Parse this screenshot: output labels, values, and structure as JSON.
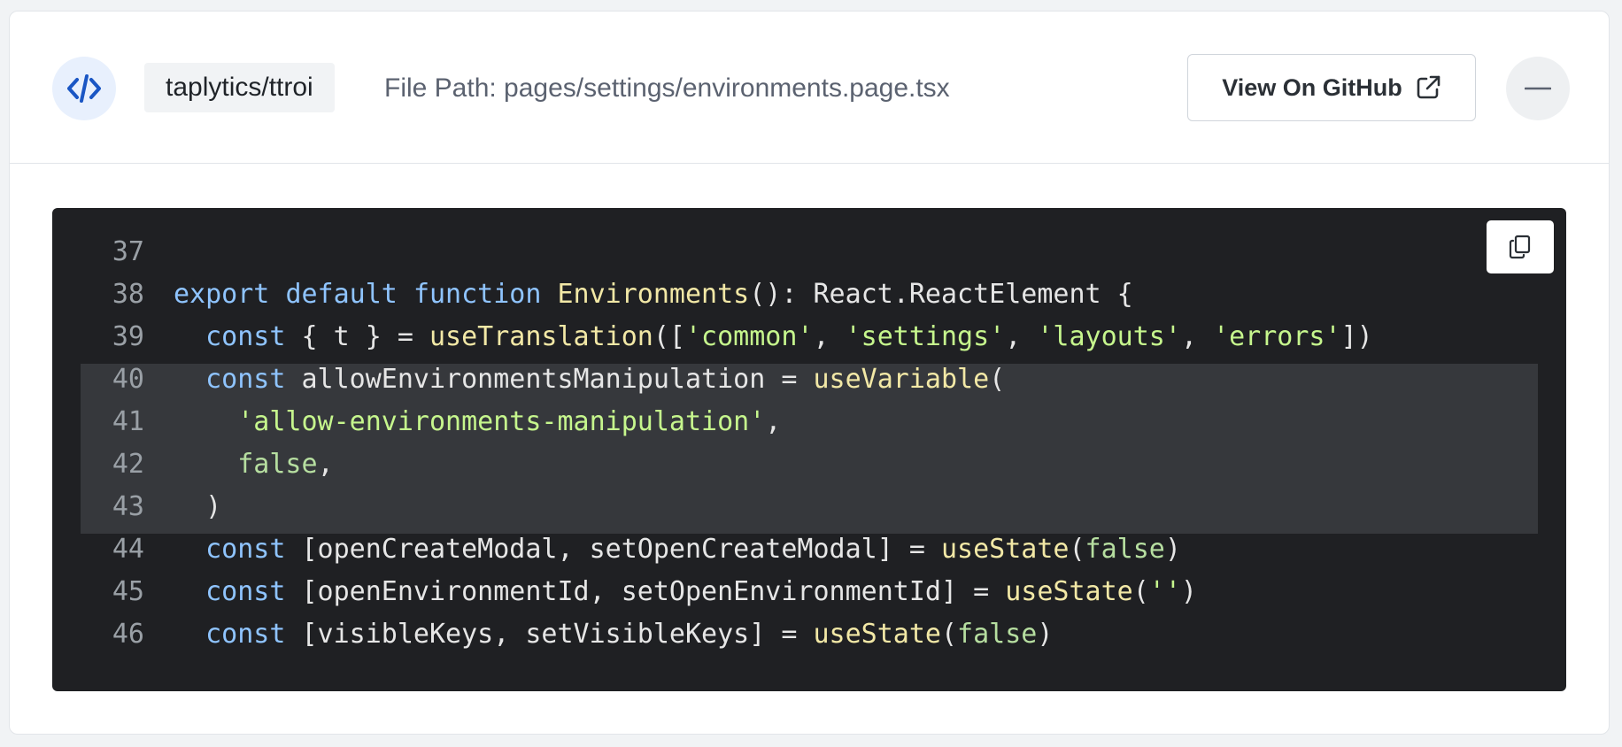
{
  "header": {
    "code_icon": "code-brackets-icon",
    "repo": "taplytics/ttroi",
    "file_path": "File Path: pages/settings/environments.page.tsx",
    "github_button_label": "View On GitHub",
    "external_icon": "external-link-icon",
    "collapse_icon": "minus-icon"
  },
  "code": {
    "copy_icon": "copy-icon",
    "highlighted_lines": [
      40,
      41,
      42,
      43
    ],
    "lines": [
      {
        "num": "37",
        "tokens": []
      },
      {
        "num": "38",
        "tokens": [
          {
            "t": "kw",
            "v": "export"
          },
          {
            "t": "pl",
            "v": " "
          },
          {
            "t": "kw",
            "v": "default"
          },
          {
            "t": "pl",
            "v": " "
          },
          {
            "t": "kw",
            "v": "function"
          },
          {
            "t": "pl",
            "v": " "
          },
          {
            "t": "fn",
            "v": "Environments"
          },
          {
            "t": "pl",
            "v": "(): React.ReactElement {"
          }
        ]
      },
      {
        "num": "39",
        "tokens": [
          {
            "t": "pl",
            "v": "  "
          },
          {
            "t": "kw",
            "v": "const"
          },
          {
            "t": "pl",
            "v": " { t } = "
          },
          {
            "t": "fn",
            "v": "useTranslation"
          },
          {
            "t": "pl",
            "v": "(["
          },
          {
            "t": "str",
            "v": "'common'"
          },
          {
            "t": "pl",
            "v": ", "
          },
          {
            "t": "str",
            "v": "'settings'"
          },
          {
            "t": "pl",
            "v": ", "
          },
          {
            "t": "str",
            "v": "'layouts'"
          },
          {
            "t": "pl",
            "v": ", "
          },
          {
            "t": "str",
            "v": "'errors'"
          },
          {
            "t": "pl",
            "v": "])"
          }
        ]
      },
      {
        "num": "40",
        "tokens": [
          {
            "t": "pl",
            "v": "  "
          },
          {
            "t": "kw",
            "v": "const"
          },
          {
            "t": "pl",
            "v": " allowEnvironmentsManipulation = "
          },
          {
            "t": "fn",
            "v": "useVariable"
          },
          {
            "t": "pl",
            "v": "("
          }
        ]
      },
      {
        "num": "41",
        "tokens": [
          {
            "t": "pl",
            "v": "    "
          },
          {
            "t": "str",
            "v": "'allow-environments-manipulation'"
          },
          {
            "t": "pl",
            "v": ","
          }
        ]
      },
      {
        "num": "42",
        "tokens": [
          {
            "t": "pl",
            "v": "    "
          },
          {
            "t": "lit",
            "v": "false"
          },
          {
            "t": "pl",
            "v": ","
          }
        ]
      },
      {
        "num": "43",
        "tokens": [
          {
            "t": "pl",
            "v": "  )"
          }
        ]
      },
      {
        "num": "44",
        "tokens": [
          {
            "t": "pl",
            "v": "  "
          },
          {
            "t": "kw",
            "v": "const"
          },
          {
            "t": "pl",
            "v": " [openCreateModal, setOpenCreateModal] = "
          },
          {
            "t": "fn",
            "v": "useState"
          },
          {
            "t": "pl",
            "v": "("
          },
          {
            "t": "lit",
            "v": "false"
          },
          {
            "t": "pl",
            "v": ")"
          }
        ]
      },
      {
        "num": "45",
        "tokens": [
          {
            "t": "pl",
            "v": "  "
          },
          {
            "t": "kw",
            "v": "const"
          },
          {
            "t": "pl",
            "v": " [openEnvironmentId, setOpenEnvironmentId] = "
          },
          {
            "t": "fn",
            "v": "useState"
          },
          {
            "t": "pl",
            "v": "("
          },
          {
            "t": "str",
            "v": "''"
          },
          {
            "t": "pl",
            "v": ")"
          }
        ]
      },
      {
        "num": "46",
        "tokens": [
          {
            "t": "pl",
            "v": "  "
          },
          {
            "t": "kw",
            "v": "const"
          },
          {
            "t": "pl",
            "v": " [visibleKeys, setVisibleKeys] = "
          },
          {
            "t": "fn",
            "v": "useState"
          },
          {
            "t": "pl",
            "v": "("
          },
          {
            "t": "lit",
            "v": "false"
          },
          {
            "t": "pl",
            "v": ")"
          }
        ]
      }
    ]
  },
  "colors": {
    "keyword": "#8fc4ff",
    "function": "#f2e8a6",
    "string": "#c6f68d",
    "literal": "#b6dea0",
    "code_background": "#1f2023",
    "highlight_background": "#36383c",
    "accent": "#1a56c4"
  }
}
